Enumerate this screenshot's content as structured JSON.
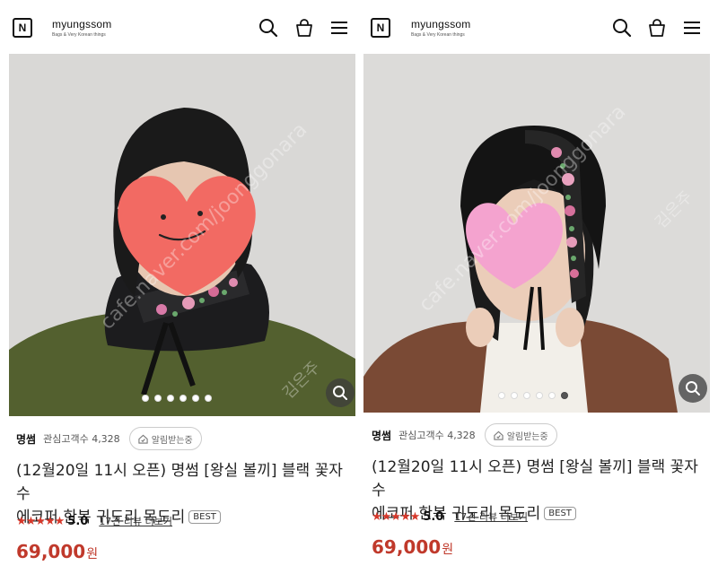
{
  "header": {
    "logo_letter": "N",
    "brand_name": "myungssom",
    "brand_tagline": "Bags & Very Korean things",
    "icons": [
      "search-icon",
      "bag-icon",
      "menu-icon"
    ]
  },
  "watermark_texts": [
    "cafe.naver.com/joonggonara",
    "김은주"
  ],
  "colors": {
    "accent": "#c0392b",
    "star": "#d6382b"
  },
  "products": [
    {
      "seller": "명썸",
      "interest_text": "관심고객수 4,328",
      "notify_label": "알림받는중",
      "title_line1": "(12월20일 11시 오픈) 명썸 [왕실 볼끼] 블랙 꽃자수",
      "title_line2": "에코퍼 한복 귀도리 목도리",
      "badge": "BEST",
      "stars": "★★★★★",
      "score": "5.0",
      "reviews_link": "17건 리뷰 더보기",
      "price": "69,000",
      "currency": "원",
      "slide_count": 6,
      "active_slide": 0
    },
    {
      "seller": "명썸",
      "interest_text": "관심고객수 4,328",
      "notify_label": "알림받는중",
      "title_line1": "(12월20일 11시 오픈) 명썸 [왕실 볼끼] 블랙 꽃자수",
      "title_line2": "에코퍼 한복 귀도리 목도리",
      "badge": "BEST",
      "stars": "★★★★★",
      "score": "5.0",
      "reviews_link": "17건 리뷰 더보기",
      "price": "69,000",
      "currency": "원",
      "slide_count": 6,
      "active_slide": 5
    }
  ]
}
